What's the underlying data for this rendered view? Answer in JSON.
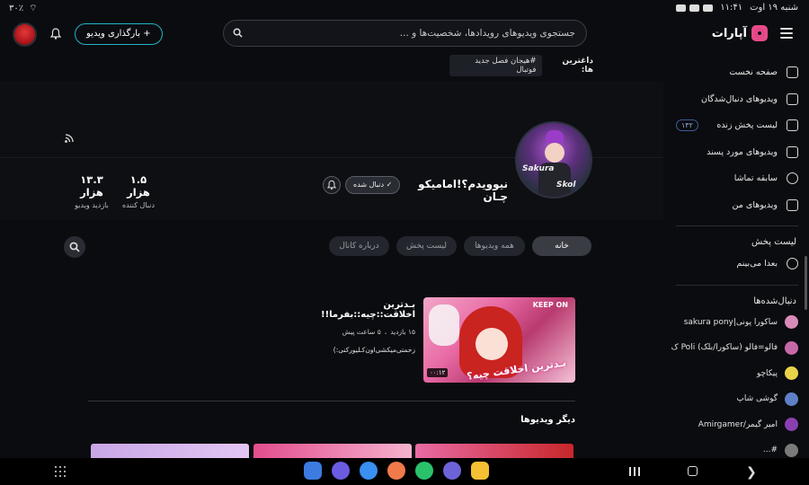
{
  "status_bar": {
    "date_time": "شنبه ۱۹ اوت",
    "clock": "۱۱:۴۱",
    "battery": "۳۰٪"
  },
  "header": {
    "logo_text": "آپارات",
    "search_placeholder": "جستجوی ویدیوهای رویدادها، شخصیت‌ها و ...",
    "upload_label": "+ بارگذاری ویدیو",
    "icons": [
      "menu-icon",
      "search-icon",
      "bell-icon",
      "avatar"
    ]
  },
  "sidebar": {
    "items": [
      {
        "label": "صفحه نخست",
        "icon": "home-icon"
      },
      {
        "label": "ویدیوهای دنبال‌شدگان",
        "icon": "subscriptions-icon"
      },
      {
        "label": "لیست پخش زنده",
        "icon": "live-icon",
        "badge": "۱۳۲"
      },
      {
        "label": "ویدیوهای مورد پسند",
        "icon": "like-icon"
      },
      {
        "label": "سابقه تماشا",
        "icon": "history-icon"
      },
      {
        "label": "ویدیوهای من",
        "icon": "my-videos-icon"
      }
    ],
    "playlist_head": "لیست پخش",
    "playlist_items": [
      {
        "label": "بعدا می‌بینم",
        "icon": "clock-icon"
      }
    ],
    "following_head": "دنبال‌شده‌ها",
    "following": [
      {
        "label": "ساکورا پونی|sakura pony",
        "color": "#d98bb8"
      },
      {
        "label": "فالو=فالو (ساکورا/بلک) Poli ک",
        "color": "#c768a8"
      },
      {
        "label": "پیکاچو",
        "color": "#e8d24a"
      },
      {
        "label": "گوشی شاپ",
        "color": "#5f7fc8"
      },
      {
        "label": "امیر گیمر/Amirgamer",
        "color": "#8a3fb0"
      },
      {
        "label": "#...",
        "color": "#7a7a7a"
      }
    ]
  },
  "hashtags": {
    "label": "داغترین ها:",
    "chip": "#هیجان فصل جدید فوتبال"
  },
  "channel": {
    "name": "نیوویدم؟!امامیکو چـان",
    "follow_label": "✓ دنبال شده",
    "avatar_text_1": "Sakura",
    "avatar_text_2": "Skol",
    "followers_value": "۱.۵ هزار",
    "followers_label": "دنبال کننده",
    "views_value": "۱۳.۳ هزار",
    "views_label": "بازدید ویدیو"
  },
  "tabs": [
    {
      "label": "خانه",
      "active": true
    },
    {
      "label": "همه ویدیوها",
      "active": false
    },
    {
      "label": "لیست پخش",
      "active": false
    },
    {
      "label": "درباره کانال",
      "active": false
    }
  ],
  "featured": {
    "title": "بـدترین اخلاقت::چیه::بفرما!!",
    "views": "۱۵ بازدید",
    "age": "۵ ساعت پیش",
    "description": "زحمتی‌میکشی‌اون‌کـلیو‌رکنی:)",
    "duration": "۰۰:۱۲",
    "thumb_caption": "بـدترین اخلاقت چیه؟",
    "thumb_corner": "KEEP ON"
  },
  "section_title": "دیگر ویدیوها",
  "colors": {
    "background": "#0b0c10",
    "accent_pink": "#e94a8a",
    "upload_border": "#22b3c8",
    "float_orange": "#d9772a"
  }
}
